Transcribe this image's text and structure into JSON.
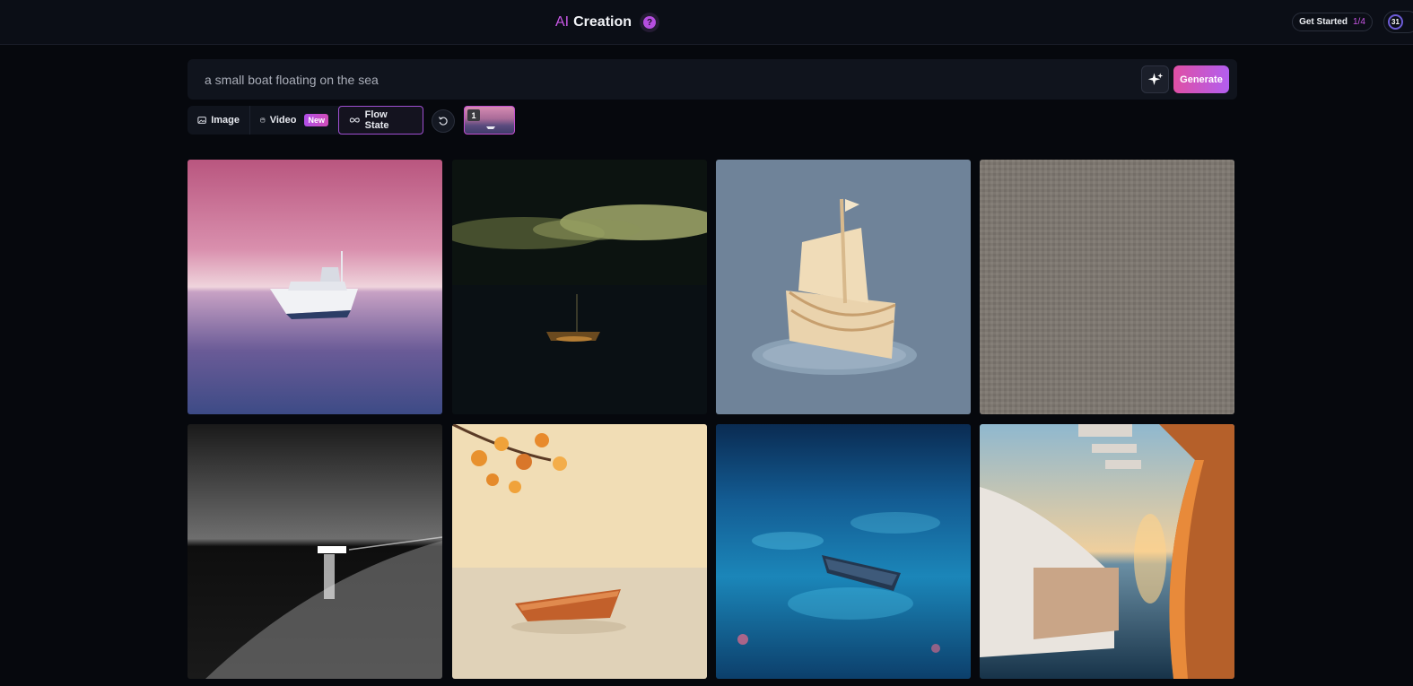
{
  "header": {
    "title_prefix": "AI",
    "title_main": "Creation",
    "help_label": "?",
    "get_started_label": "Get Started",
    "get_started_progress": "1/4",
    "credits": "31"
  },
  "prompt": {
    "value": "a small boat floating on the sea",
    "enhance_icon": "sparkle-icon",
    "generate_label": "Generate"
  },
  "modes": {
    "image_label": "Image",
    "video_label": "Video",
    "video_badge": "New",
    "flow_label": "Flow State",
    "selected": "Flow State"
  },
  "history": {
    "thumb_index": "1"
  },
  "gallery": {
    "images": [
      "pink-sky-motorboat",
      "night-bokeh-boat",
      "clay-sailboat",
      "gray-noise-texture",
      "monochrome-night-boat",
      "autumn-rowboat-illustration",
      "glowing-blue-water-rowboat",
      "sunset-ship-deck"
    ]
  }
}
